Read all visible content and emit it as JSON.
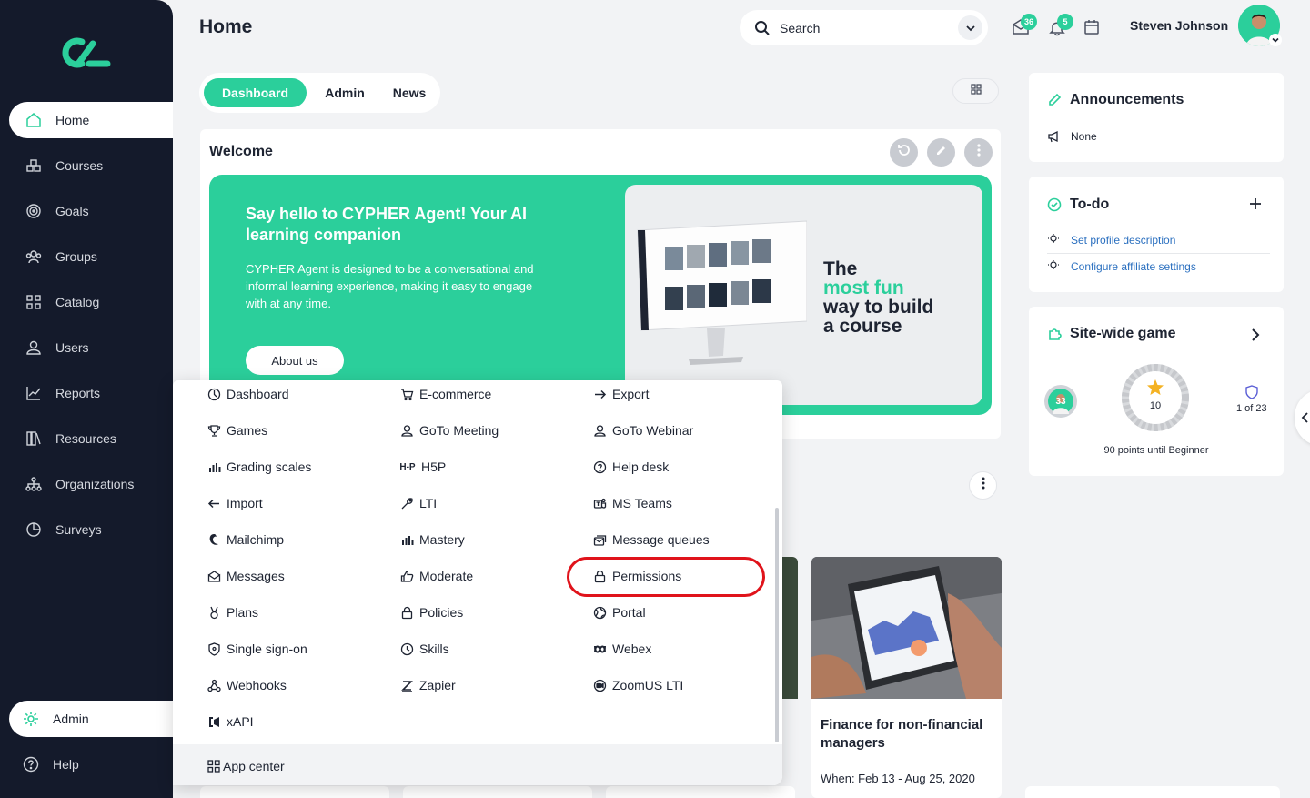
{
  "sidebar": {
    "items": [
      {
        "label": "Home",
        "icon": "home-icon"
      },
      {
        "label": "Courses",
        "icon": "courses-icon"
      },
      {
        "label": "Goals",
        "icon": "goals-icon"
      },
      {
        "label": "Groups",
        "icon": "groups-icon"
      },
      {
        "label": "Catalog",
        "icon": "catalog-icon"
      },
      {
        "label": "Users",
        "icon": "user-icon"
      },
      {
        "label": "Reports",
        "icon": "reports-icon"
      },
      {
        "label": "Resources",
        "icon": "resources-icon"
      },
      {
        "label": "Organizations",
        "icon": "organizations-icon"
      },
      {
        "label": "Surveys",
        "icon": "surveys-icon"
      }
    ],
    "admin": {
      "label": "Admin",
      "icon": "gear-icon"
    },
    "help": {
      "label": "Help",
      "icon": "help-icon"
    }
  },
  "header": {
    "title": "Home",
    "search_placeholder": "Search",
    "messages_count": "36",
    "notifications_count": "5",
    "user_name": "Steven Johnson"
  },
  "tabs": [
    {
      "label": "Dashboard",
      "active": true
    },
    {
      "label": "Admin",
      "active": false
    },
    {
      "label": "News",
      "active": false
    }
  ],
  "welcome": {
    "title": "Welcome",
    "hero_title": "Say hello to CYPHER Agent! Your AI learning companion",
    "hero_text": "CYPHER Agent is designed to be a conversational and informal learning experience, making it easy to engage with at any time.",
    "button": "About us",
    "promo_line1": "The",
    "promo_line2": "most fun",
    "promo_line3": "way to build",
    "promo_line4": "a course"
  },
  "announcements": {
    "title": "Announcements",
    "value": "None"
  },
  "todo": {
    "title": "To-do",
    "items": [
      "Set profile description",
      "Configure affiliate settings"
    ]
  },
  "game": {
    "title": "Site-wide game",
    "level": "33",
    "points": "10",
    "rank": "1 of 23",
    "progress_text": "90 points until Beginner"
  },
  "admin_menu": {
    "col1": [
      "Dashboard",
      "Games",
      "Grading scales",
      "Import",
      "Mailchimp",
      "Messages",
      "Plans",
      "Single sign-on",
      "Webhooks",
      "xAPI"
    ],
    "col2": [
      "E-commerce",
      "GoTo Meeting",
      "H5P",
      "LTI",
      "Mastery",
      "Moderate",
      "Policies",
      "Skills",
      "Zapier"
    ],
    "col3": [
      "Export",
      "GoTo Webinar",
      "Help desk",
      "MS Teams",
      "Message queues",
      "Permissions",
      "Portal",
      "Webex",
      "ZoomUS LTI"
    ],
    "footer": "App center"
  },
  "course": {
    "title": "Finance for non-financial managers",
    "when": "When: Feb 13 - Aug 25, 2020"
  },
  "colors": {
    "accent": "#2bcf9b",
    "sidebar": "#141a2b",
    "highlight": "#e0131b"
  }
}
